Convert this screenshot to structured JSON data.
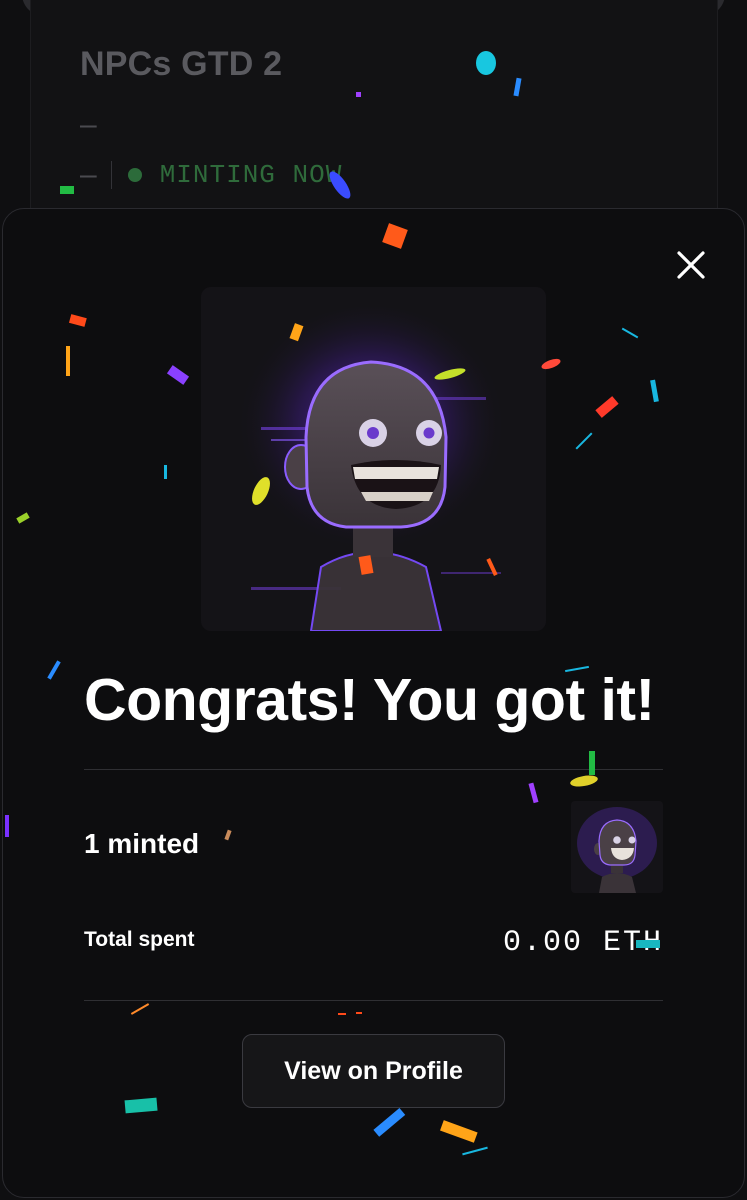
{
  "background": {
    "collection_title": "NPCs GTD 2",
    "dash_1": "–",
    "dash_2": "–",
    "status": "MINTING NOW",
    "status_color": "#2f6b3b"
  },
  "modal": {
    "close_icon": "close-icon",
    "headline": "Congrats! You got it!",
    "minted_label": "1 minted",
    "total_spent_label": "Total spent",
    "total_spent_value": "0.00 ETH",
    "view_button_label": "View on Profile"
  },
  "colors": {
    "modal_bg": "#0d0d0f",
    "accent_purple": "#8a4dff",
    "button_border": "#3a3a40"
  }
}
